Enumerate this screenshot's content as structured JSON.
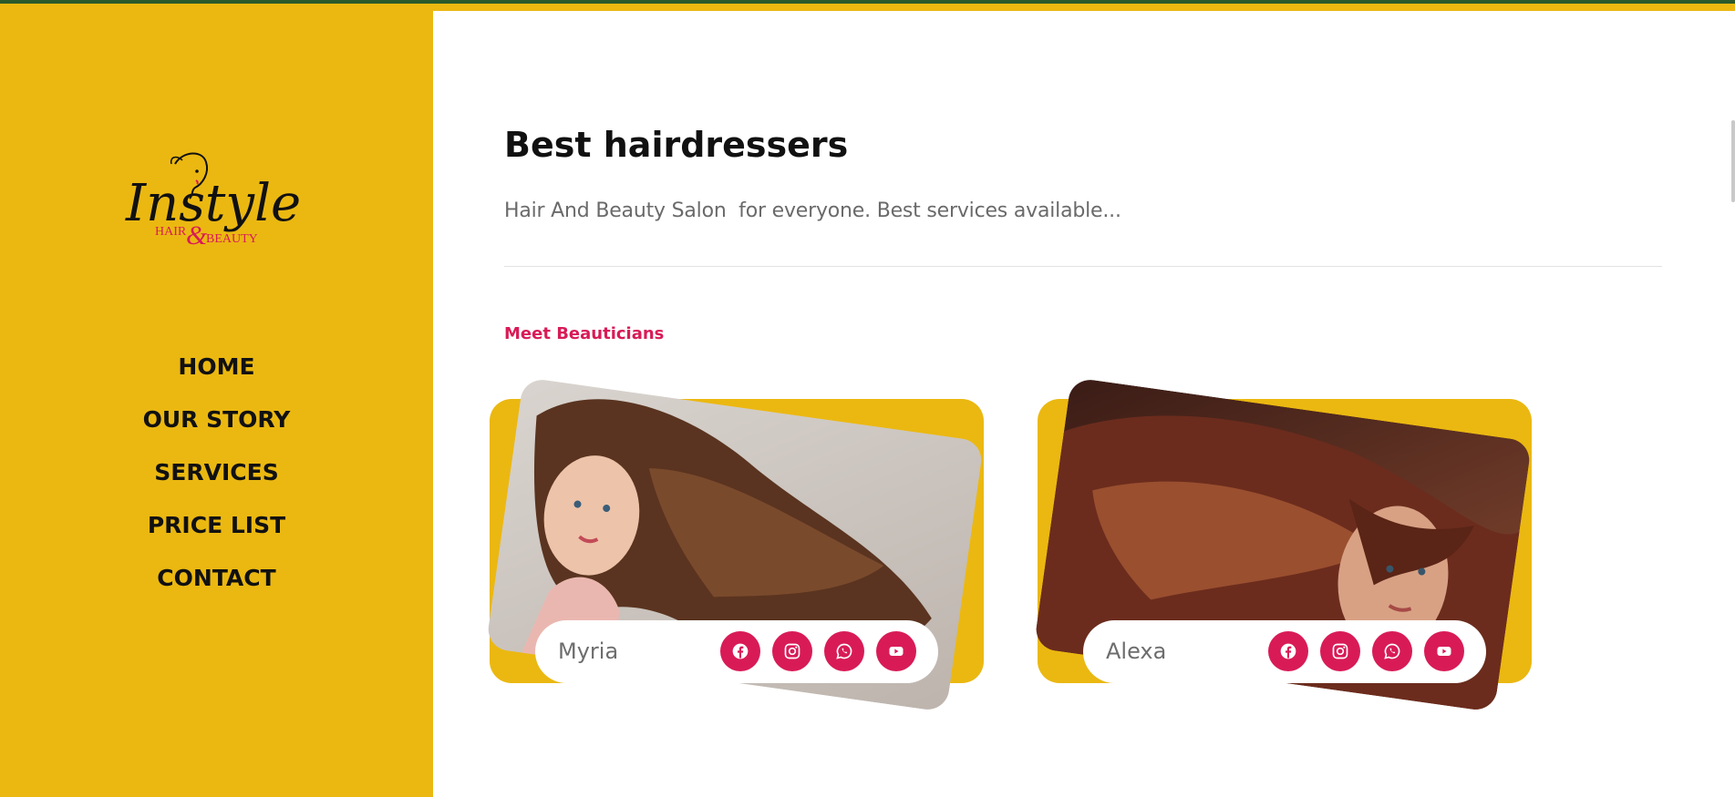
{
  "brand": {
    "logo_text": "Instyle",
    "logo_subtext": "HAIR & BEAUTY",
    "accent_color": "#ebb811",
    "highlight_color": "#d81b57"
  },
  "nav": {
    "items": [
      "HOME",
      "OUR STORY",
      "SERVICES",
      "PRICE LIST",
      "CONTACT"
    ]
  },
  "main": {
    "title": "Best hairdressers",
    "subtitle": "Hair And Beauty Salon  for everyone. Best services available...",
    "section_label": "Meet Beauticians"
  },
  "beauticians": [
    {
      "name": "Myria",
      "socials": [
        "facebook-icon",
        "instagram-icon",
        "whatsapp-icon",
        "youtube-icon"
      ]
    },
    {
      "name": "Alexa",
      "socials": [
        "facebook-icon",
        "instagram-icon",
        "whatsapp-icon",
        "youtube-icon"
      ]
    }
  ]
}
